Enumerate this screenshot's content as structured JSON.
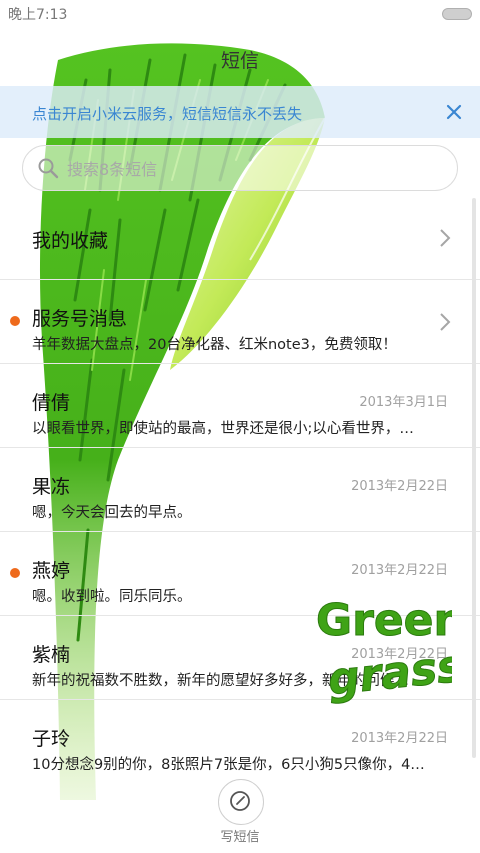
{
  "status_bar": {
    "time": "晚上7:13"
  },
  "header": {
    "title": "短信"
  },
  "notice": {
    "text": "点击开启小米云服务，短信短信永不丢失"
  },
  "search": {
    "placeholder": "搜索8条短信"
  },
  "list": [
    {
      "title": "我的收藏",
      "preview": "",
      "date": "",
      "unread": false,
      "chevron": true
    },
    {
      "title": "服务号消息",
      "preview": "羊年数据大盘点，20台净化器、红米note3，免费领取！",
      "date": "",
      "unread": true,
      "chevron": true
    },
    {
      "title": "倩倩",
      "preview": "以眼看世界，即使站的最高，世界还是很小;以心看世界，…",
      "date": "2013年3月1日",
      "unread": false,
      "chevron": false
    },
    {
      "title": "果冻",
      "preview": "嗯，今天会回去的早点。",
      "date": "2013年2月22日",
      "unread": false,
      "chevron": false
    },
    {
      "title": "燕婷",
      "preview": "嗯。收到啦。同乐同乐。",
      "date": "2013年2月22日",
      "unread": true,
      "chevron": false
    },
    {
      "title": "紫楠",
      "preview": "新年的祝福数不胜数，新年的愿望好多好多，新年的问候…",
      "date": "2013年2月22日",
      "unread": false,
      "chevron": false
    },
    {
      "title": "子玲",
      "preview": "10分想念9别的你，8张照片7张是你，6只小狗5只像你，4…",
      "date": "2013年2月22日",
      "unread": false,
      "chevron": false
    }
  ],
  "compose": {
    "label": "写短信"
  },
  "watermark": {
    "line1": "Green",
    "line2": "grass"
  },
  "colors": {
    "accent": "#3a86d2",
    "unread": "#ee6a1c",
    "grass": "#3fa316",
    "leaf": "#b6e44a"
  }
}
